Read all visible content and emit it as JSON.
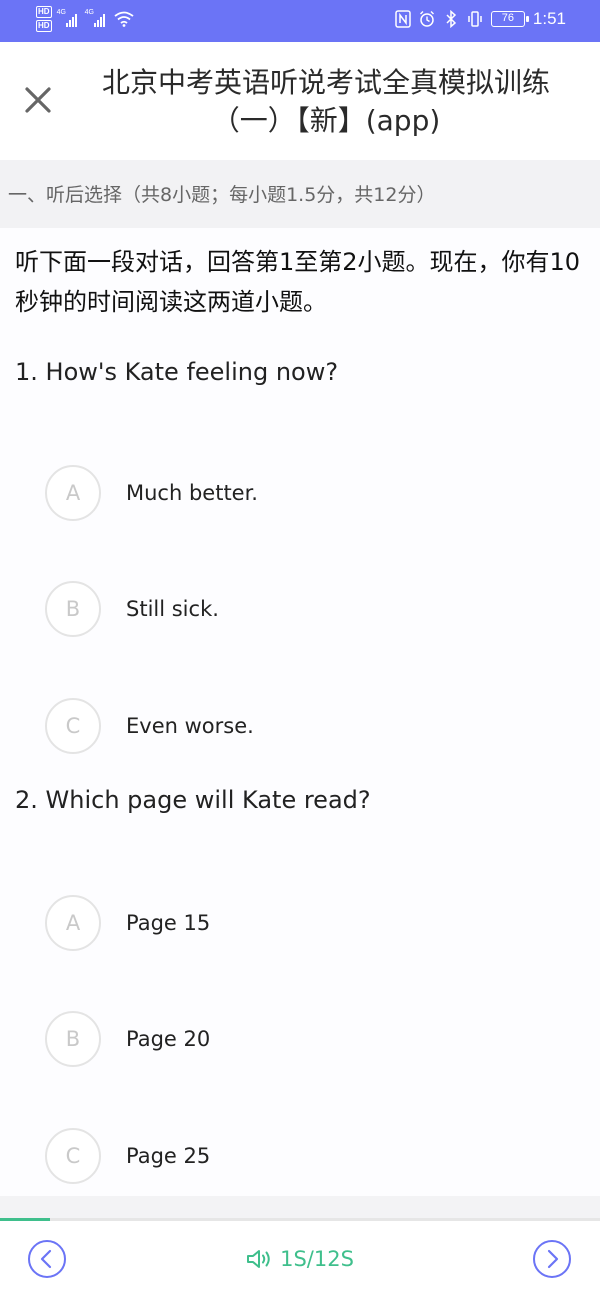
{
  "status_bar": {
    "hd1": "HD",
    "hd2": "HD",
    "net1": "4G",
    "net2": "4G",
    "battery": "76",
    "time": "1:51"
  },
  "header": {
    "title": "北京中考英语听说考试全真模拟训练（一）【新】(app)"
  },
  "section": {
    "label": "一、听后选择（共8小题；每小题1.5分，共12分）"
  },
  "intro": "听下面一段对话，回答第1至第2小题。现在，你有10秒钟的时间阅读这两道小题。",
  "questions": [
    {
      "text": "1. How's Kate feeling now?",
      "options": [
        {
          "letter": "A",
          "text": "Much better."
        },
        {
          "letter": "B",
          "text": "Still sick."
        },
        {
          "letter": "C",
          "text": "Even worse."
        }
      ]
    },
    {
      "text": "2. Which page will Kate read?",
      "options": [
        {
          "letter": "A",
          "text": "Page 15"
        },
        {
          "letter": "B",
          "text": "Page 20"
        },
        {
          "letter": "C",
          "text": "Page 25"
        }
      ]
    }
  ],
  "bottom": {
    "timer": "1S/12S",
    "progress_fraction": 0.083,
    "accent_color": "#3fbf8c",
    "nav_color": "#6b74f6"
  }
}
